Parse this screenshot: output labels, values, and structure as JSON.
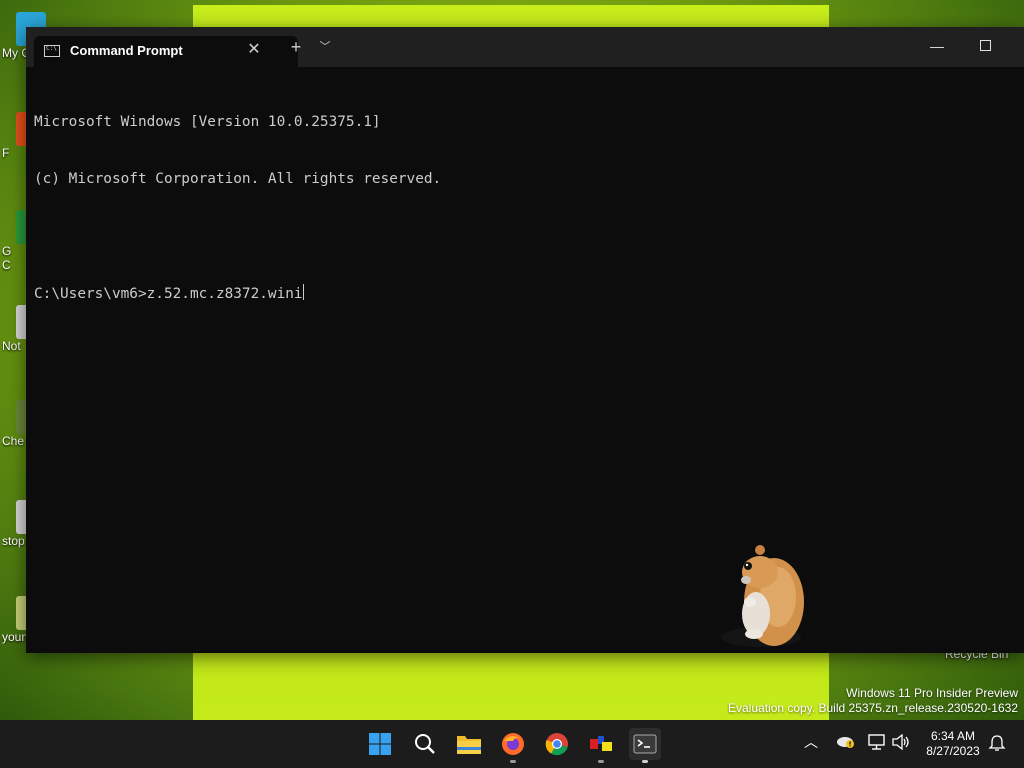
{
  "desktop": {
    "icons": [
      {
        "label": "My C",
        "color": "#2aa6d8"
      },
      {
        "label": "F",
        "color": "#e8501c"
      },
      {
        "label": "G\nC",
        "color": "#2a9a3a"
      },
      {
        "label": "Not",
        "color": "#d8d8d8"
      },
      {
        "label": "Che",
        "color": "#6a8a3a"
      },
      {
        "label": "stop",
        "color": "#d8d8d8"
      },
      {
        "label": "youneverdo...",
        "color": "#c9d27a"
      }
    ],
    "recycle_bin_label": "Recycle Bin",
    "watermark": {
      "line1": "Windows 11 Pro Insider Preview",
      "line2": "Evaluation copy. Build 25375.zn_release.230520-1632"
    }
  },
  "window": {
    "tab_title": "Command Prompt",
    "console_lines": [
      "Microsoft Windows [Version 10.0.25375.1]",
      "(c) Microsoft Corporation. All rights reserved.",
      "",
      "C:\\Users\\vm6>z.52.mc.z8372.wini"
    ]
  },
  "taskbar": {
    "apps": [
      "start-icon",
      "search-icon",
      "file-explorer-icon",
      "firefox-icon",
      "chrome-icon",
      "app-icon",
      "terminal-icon"
    ],
    "clock": {
      "time": "6:34 AM",
      "date": "8/27/2023"
    }
  },
  "colors": {
    "terminal_bg": "#0c0c0c",
    "terminal_text": "#cccccc",
    "titlebar": "#202020",
    "taskbar": "#1c1c1c",
    "wallpaper_accent": "#c4ea1a"
  }
}
